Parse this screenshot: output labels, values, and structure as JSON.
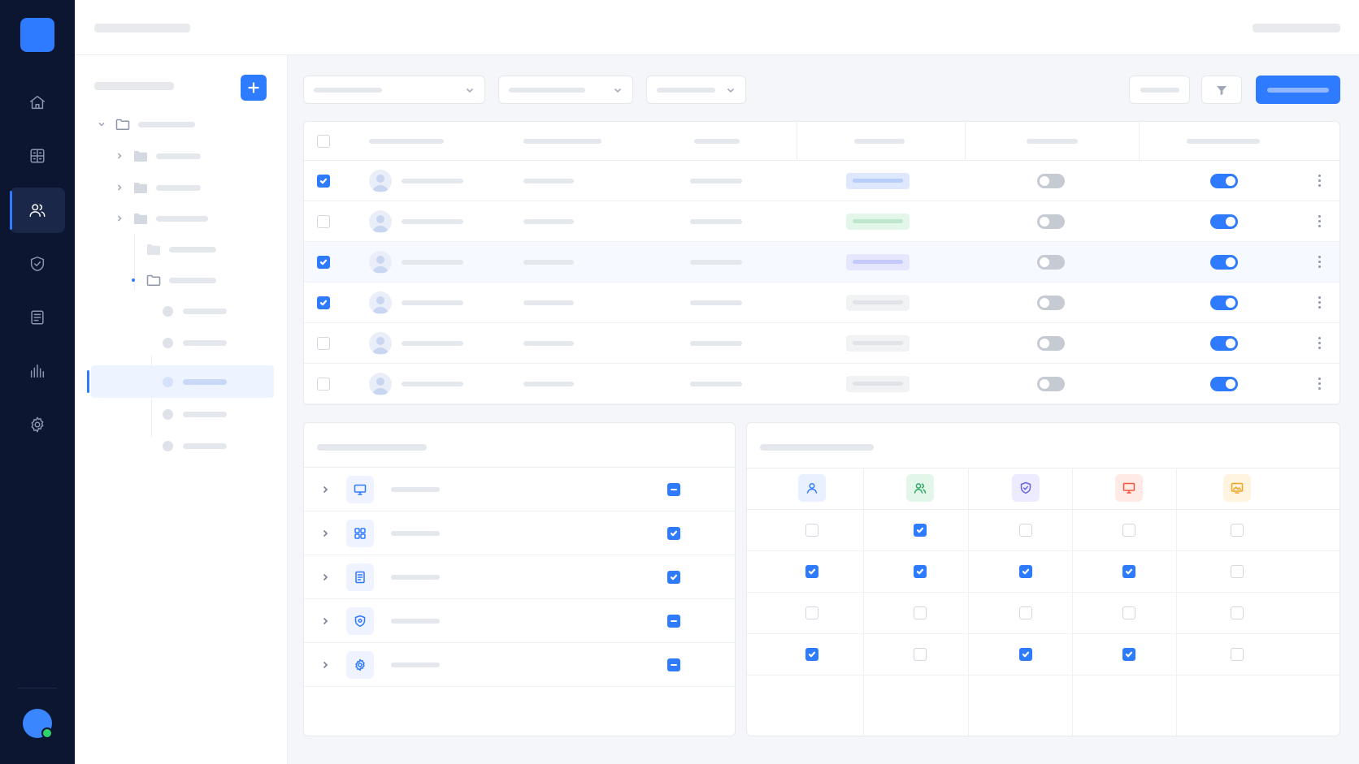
{
  "rail": {
    "items": [
      {
        "name": "home-icon",
        "active": false
      },
      {
        "name": "grid-icon",
        "active": false
      },
      {
        "name": "users-icon",
        "active": true
      },
      {
        "name": "shield-check-icon",
        "active": false
      },
      {
        "name": "document-icon",
        "active": false
      },
      {
        "name": "bar-chart-icon",
        "active": false
      },
      {
        "name": "gear-icon",
        "active": false
      }
    ],
    "user_status": "online"
  },
  "tree": {
    "add_icon": "plus-icon",
    "nodes": [
      {
        "type": "folder-open",
        "level": 0,
        "expanded": true
      },
      {
        "type": "folder",
        "level": 1,
        "expanded": false
      },
      {
        "type": "folder",
        "level": 1,
        "expanded": false
      },
      {
        "type": "folder",
        "level": 1,
        "expanded": false
      },
      {
        "type": "folder",
        "level": 2,
        "expanded": false
      },
      {
        "type": "folder-open",
        "level": 2,
        "expanded": true
      },
      {
        "type": "leaf",
        "level": 3
      },
      {
        "type": "leaf",
        "level": 3
      },
      {
        "type": "leaf",
        "level": 3,
        "selected": true
      },
      {
        "type": "leaf",
        "level": 3
      },
      {
        "type": "leaf",
        "level": 3
      }
    ]
  },
  "toolbar": {
    "filter_icon": "filter-icon",
    "dropdown_icon": "chevron-down-icon"
  },
  "users_table": {
    "rows": [
      {
        "checked": true,
        "badge_color": "#dde8ff",
        "badge_bar": "#b9cffb",
        "toggle_a": false,
        "toggle_b": true,
        "highlight": false
      },
      {
        "checked": false,
        "badge_color": "#e3f6ea",
        "badge_bar": "#bfe7cd",
        "toggle_a": false,
        "toggle_b": true,
        "highlight": false
      },
      {
        "checked": true,
        "badge_color": "#e6e7ff",
        "badge_bar": "#c5c9fb",
        "toggle_a": false,
        "toggle_b": true,
        "highlight": true
      },
      {
        "checked": true,
        "badge_color": "#f1f2f4",
        "badge_bar": "#e1e3e8",
        "toggle_a": false,
        "toggle_b": true,
        "highlight": false
      },
      {
        "checked": false,
        "badge_color": "#f1f2f4",
        "badge_bar": "#e1e3e8",
        "toggle_a": false,
        "toggle_b": true,
        "highlight": false
      },
      {
        "checked": false,
        "badge_color": "#f1f2f4",
        "badge_bar": "#e1e3e8",
        "toggle_a": false,
        "toggle_b": true,
        "highlight": false
      }
    ]
  },
  "modules": [
    {
      "icon": "monitor-icon",
      "state": "partial"
    },
    {
      "icon": "apps-icon",
      "state": "checked"
    },
    {
      "icon": "document-icon",
      "state": "checked"
    },
    {
      "icon": "shield-icon",
      "state": "partial"
    },
    {
      "icon": "gear-icon",
      "state": "partial"
    }
  ],
  "roles": [
    {
      "icon": "user-icon",
      "bg": "#e9f0ff",
      "color": "#2f7bff"
    },
    {
      "icon": "users-icon",
      "bg": "#e3f6ea",
      "color": "#2faa63"
    },
    {
      "icon": "shield-check-icon",
      "bg": "#ecebff",
      "color": "#6b63e8"
    },
    {
      "icon": "monitor-icon",
      "bg": "#ffeae6",
      "color": "#f0553a"
    },
    {
      "icon": "image-icon",
      "bg": "#fff4df",
      "color": "#f0a421"
    }
  ],
  "permission_matrix": [
    [
      false,
      true,
      false,
      false,
      false
    ],
    [
      true,
      true,
      true,
      true,
      false
    ],
    [
      false,
      false,
      false,
      false,
      false
    ],
    [
      true,
      false,
      true,
      true,
      false
    ]
  ],
  "colors": {
    "accent": "#2f7bff",
    "rail_bg": "#0d1631",
    "online": "#2ed26a"
  }
}
